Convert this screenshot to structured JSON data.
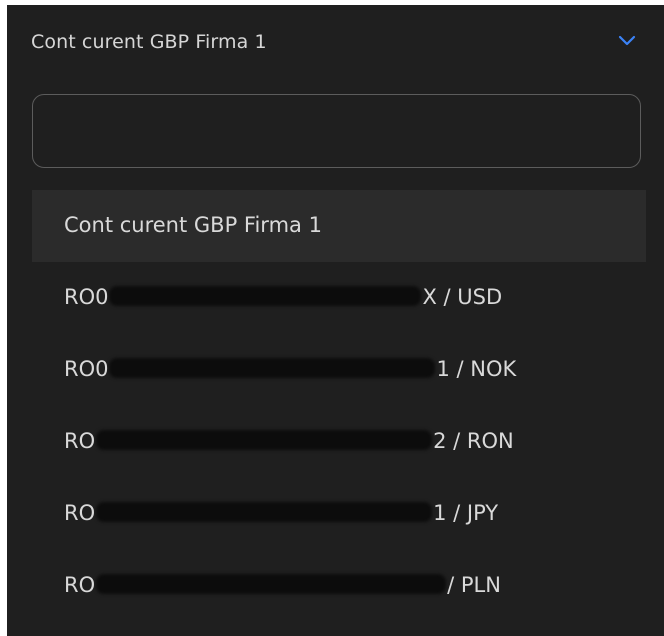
{
  "select": {
    "selected_value": "Cont curent GBP Firma 1",
    "chevron_icon": "chevron-down-icon",
    "chevron_color": "#3b82f6"
  },
  "search": {
    "value": "",
    "placeholder": ""
  },
  "options": [
    {
      "label": "Cont curent GBP Firma 1",
      "selected": true
    },
    {
      "prefix": "RO0",
      "suffix": "X / USD",
      "redacted": true
    },
    {
      "prefix": "RO0",
      "suffix": "1 / NOK",
      "redacted": true
    },
    {
      "prefix": "RO",
      "suffix": "2 / RON",
      "redacted": true
    },
    {
      "prefix": "RO",
      "suffix": "1 / JPY",
      "redacted": true
    },
    {
      "prefix": "RO",
      "suffix": "/ PLN",
      "redacted": true
    }
  ],
  "colors": {
    "panel_bg": "#1f1f1f",
    "selected_bg": "#2b2b2b",
    "text": "#d9d9d9",
    "border": "#5c5c5c"
  }
}
